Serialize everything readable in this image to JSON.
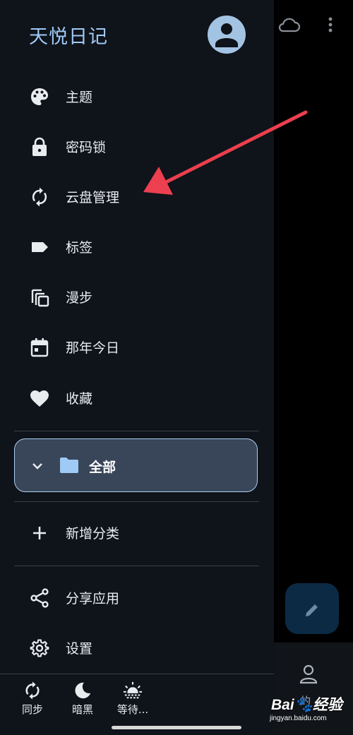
{
  "drawer": {
    "title": "天悦日记",
    "menu": [
      {
        "label": "主题",
        "icon": "palette-icon"
      },
      {
        "label": "密码锁",
        "icon": "lock-icon"
      },
      {
        "label": "云盘管理",
        "icon": "sync-icon"
      },
      {
        "label": "标签",
        "icon": "label-icon"
      },
      {
        "label": "漫步",
        "icon": "copy-icon"
      },
      {
        "label": "那年今日",
        "icon": "calendar-icon"
      },
      {
        "label": "收藏",
        "icon": "heart-icon"
      }
    ],
    "folder": {
      "label": "全部",
      "icon": "folder-icon"
    },
    "add_category": {
      "label": "新增分类",
      "icon": "plus-icon"
    },
    "share": {
      "label": "分享应用",
      "icon": "share-icon"
    },
    "settings": {
      "label": "设置",
      "icon": "gear-icon"
    },
    "bottom_bar": [
      {
        "label": "同步",
        "icon": "sync-icon"
      },
      {
        "label": "暗黑",
        "icon": "moon-icon"
      },
      {
        "label": "等待...",
        "icon": "sun-icon"
      }
    ]
  },
  "background": {
    "tab_label": "的"
  },
  "watermark": {
    "logo": "Bai du 经验",
    "url": "jingyan.baidu.com"
  },
  "colors": {
    "drawer_bg": "#0f131a",
    "title": "#9fcaf5",
    "folder_card_bg": "#394558",
    "folder_card_border": "#a9d0f2",
    "fab_bg": "#0c2a44",
    "annotation_arrow": "#ec3f4f"
  }
}
